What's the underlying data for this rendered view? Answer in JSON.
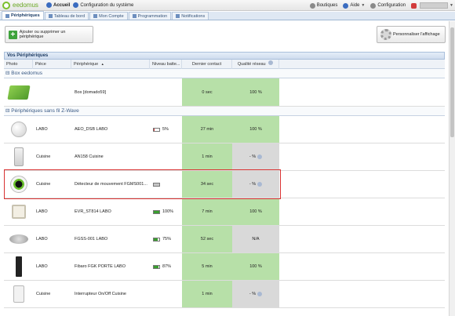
{
  "topbar": {
    "logo_text": "eedomus",
    "home": "Accueil",
    "config_system": "Configuration du système",
    "boutiques": "Boutiques",
    "aide": "Aide",
    "configuration": "Configuration"
  },
  "tabs": [
    {
      "label": "Périphériques",
      "active": true
    },
    {
      "label": "Tableau de bord",
      "active": false
    },
    {
      "label": "Mon Compte",
      "active": false
    },
    {
      "label": "Programmation",
      "active": false
    },
    {
      "label": "Notifications",
      "active": false
    }
  ],
  "actions": {
    "add_remove": "Ajouter ou supprimer un périphérique",
    "customize": "Personnaliser l'affichage"
  },
  "panel_title": "Vos Périphériques",
  "columns": {
    "photo": "Photo",
    "piece": "Pièce",
    "device": "Périphérique",
    "device_sort": "▲",
    "battery": "Niveau batte...",
    "contact": "Dernier contact",
    "quality": "Qualité réseau"
  },
  "groups": [
    {
      "label": "Box eedomus",
      "rows": [
        {
          "piece": "",
          "device": "Box [domado59]",
          "battery": "",
          "battery_level": null,
          "contact": "0 sec",
          "contact_state": "green",
          "quality": "100 %",
          "quality_state": "green",
          "quality_icon": false,
          "thumb": "box"
        }
      ]
    },
    {
      "label": "Périphériques sans fil Z-Wave",
      "rows": [
        {
          "piece": "LABO",
          "device": "AEO_DSB LABO",
          "battery": "5%",
          "battery_level": 0.05,
          "contact": "27 min",
          "contact_state": "green",
          "quality": "100 %",
          "quality_state": "green",
          "quality_icon": false,
          "thumb": "sphere"
        },
        {
          "piece": "Cuisine",
          "device": "AN158 Cuisine",
          "battery": "",
          "battery_level": null,
          "contact": "1 min",
          "contact_state": "green",
          "quality": "- %",
          "quality_state": "grey",
          "quality_icon": true,
          "thumb": "plug"
        },
        {
          "piece": "Cuisine",
          "device": "Détecteur de mouvement FGMS001...",
          "battery": "",
          "battery_level": 0,
          "contact": "34 sec",
          "contact_state": "green",
          "quality": "- %",
          "quality_state": "grey",
          "quality_icon": true,
          "thumb": "eye",
          "highlighted": true
        },
        {
          "piece": "LABO",
          "device": "EVR_ST814 LABO",
          "battery": "100%",
          "battery_level": 1.0,
          "contact": "7 min",
          "contact_state": "green",
          "quality": "100 %",
          "quality_state": "green",
          "quality_icon": false,
          "thumb": "thermo"
        },
        {
          "piece": "LABO",
          "device": "FGSS-001 LABO",
          "battery": "75%",
          "battery_level": 0.75,
          "contact": "52 sec",
          "contact_state": "green",
          "quality": "N/A",
          "quality_state": "grey",
          "quality_icon": false,
          "thumb": "smoke"
        },
        {
          "piece": "LABO",
          "device": "Fibaro FGK PORTE LABO",
          "battery": "87%",
          "battery_level": 0.87,
          "contact": "5 min",
          "contact_state": "green",
          "quality": "100 %",
          "quality_state": "green",
          "quality_icon": false,
          "thumb": "door"
        },
        {
          "piece": "Cuisine",
          "device": "Interrupteur On/Off Cuisine",
          "battery": "",
          "battery_level": null,
          "contact": "1 min",
          "contact_state": "green",
          "quality": "- %",
          "quality_state": "grey",
          "quality_icon": true,
          "thumb": "switch"
        }
      ]
    }
  ]
}
